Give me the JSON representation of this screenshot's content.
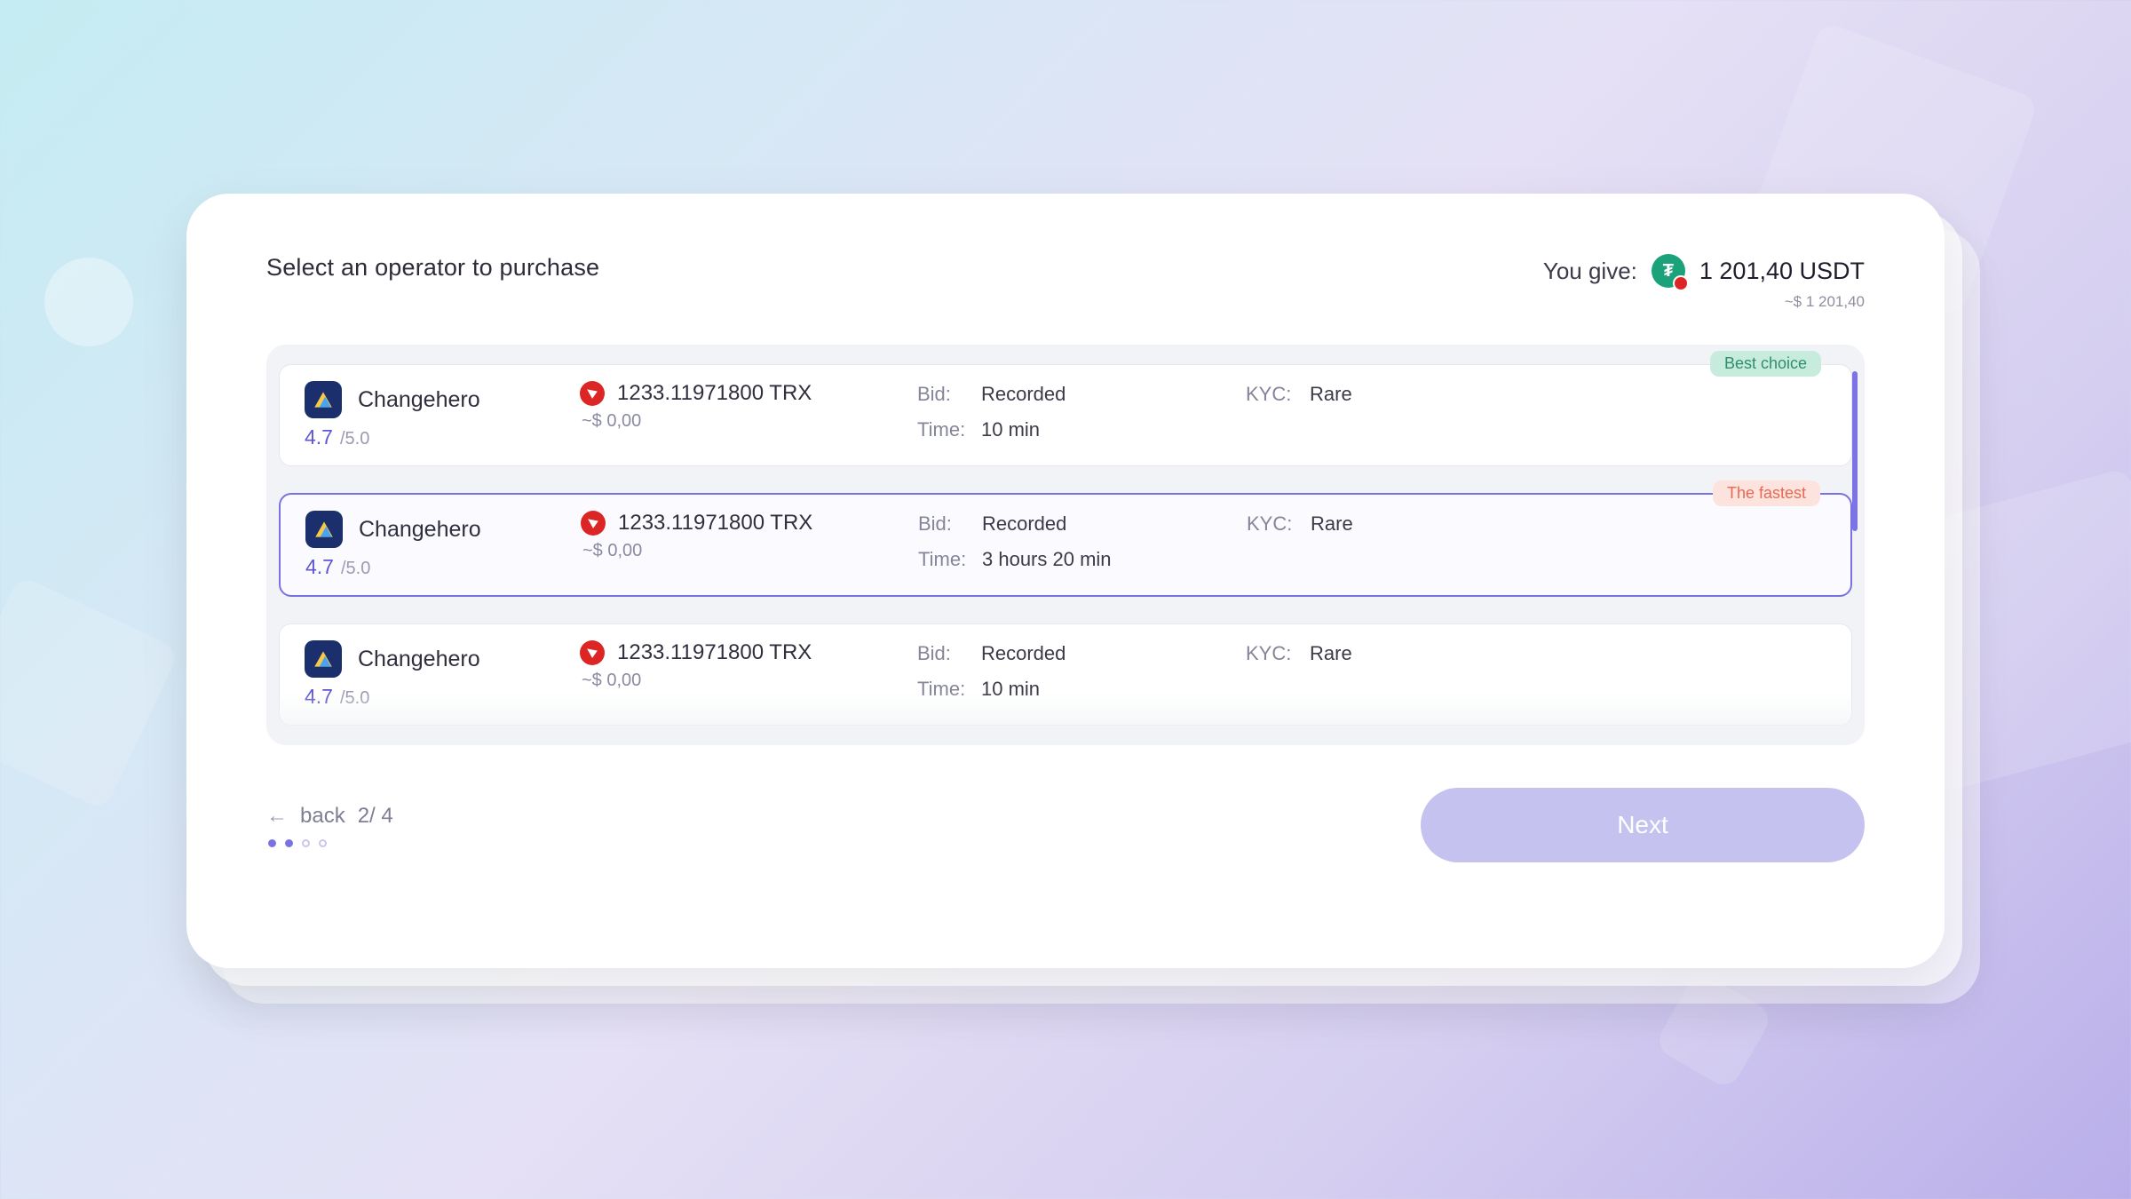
{
  "title": "Select an operator to purchase",
  "you_give": {
    "label": "You give:",
    "amount": "1 201,40 USDT",
    "approx": "~$ 1 201,40"
  },
  "badges": {
    "best": "Best choice",
    "fast": "The fastest"
  },
  "labels": {
    "bid": "Bid:",
    "time": "Time:",
    "kyc": "KYC:"
  },
  "operators": [
    {
      "name": "Changehero",
      "rating": "4.7",
      "rating_max": "/5.0",
      "amount": "1233.11971800 TRX",
      "approx": "~$ 0,00",
      "bid": "Recorded",
      "time": "10 min",
      "kyc": "Rare",
      "badge": "best",
      "selected": false
    },
    {
      "name": "Changehero",
      "rating": "4.7",
      "rating_max": "/5.0",
      "amount": "1233.11971800 TRX",
      "approx": "~$ 0,00",
      "bid": "Recorded",
      "time": "3 hours 20 min",
      "kyc": "Rare",
      "badge": "fast",
      "selected": true
    },
    {
      "name": "Changehero",
      "rating": "4.7",
      "rating_max": "/5.0",
      "amount": "1233.11971800 TRX",
      "approx": "~$ 0,00",
      "bid": "Recorded",
      "time": "10 min",
      "kyc": "Rare",
      "badge": null,
      "selected": false
    }
  ],
  "footer": {
    "back": "back",
    "step": "2/ 4",
    "next": "Next"
  }
}
